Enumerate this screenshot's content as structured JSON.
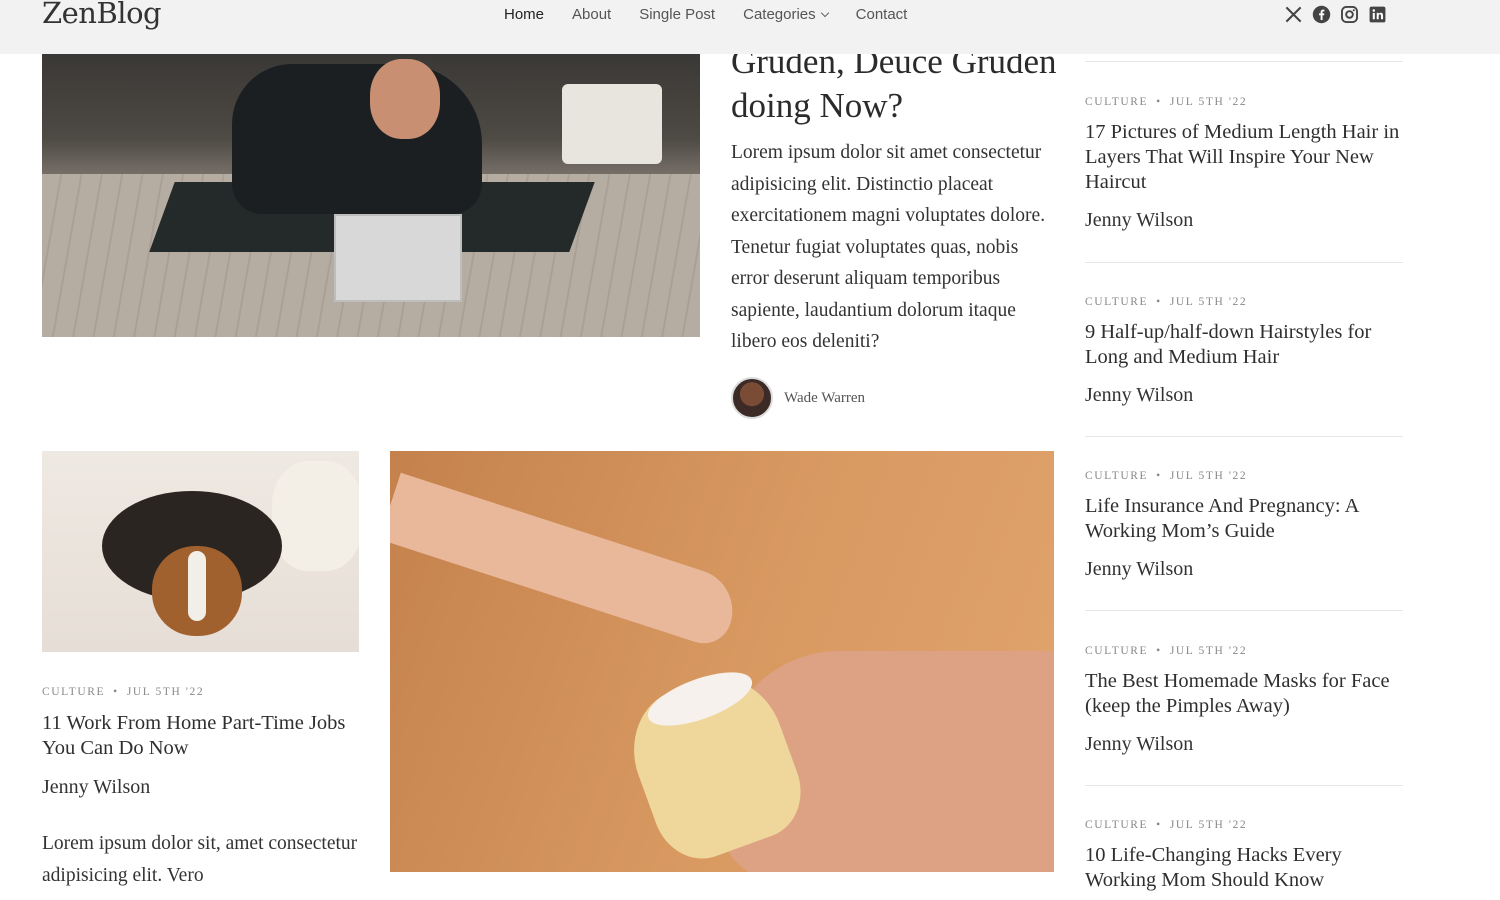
{
  "header": {
    "logo": "ZenBlog",
    "nav": [
      {
        "label": "Home"
      },
      {
        "label": "About"
      },
      {
        "label": "Single Post"
      },
      {
        "label": "Categories"
      },
      {
        "label": "Contact"
      }
    ],
    "social_icons": [
      "x-icon",
      "facebook-icon",
      "instagram-icon",
      "linkedin-icon"
    ]
  },
  "hero": {
    "title": "Gruden, Deuce Gruden doing Now?",
    "excerpt": "Lorem ipsum dolor sit amet consectetur adipisicing elit. Distinctio placeat exercitationem magni voluptates dolore. Tenetur fugiat voluptates quas, nobis error deserunt aliquam temporibus sapiente, laudantium dolorum itaque libero eos deleniti?",
    "author": "Wade Warren"
  },
  "card": {
    "category": "Culture",
    "date": "Jul 5th '22",
    "title": "11 Work From Home Part-Time Jobs You Can Do Now",
    "author": "Jenny Wilson",
    "excerpt": "Lorem ipsum dolor sit, amet consectetur adipisicing elit. Vero"
  },
  "sidebar": {
    "items": [
      {
        "category": "Culture",
        "date": "Jul 5th '22",
        "title": "17 Pictures of Medium Length Hair in Layers That Will Inspire Your New Haircut",
        "author": "Jenny Wilson"
      },
      {
        "category": "Culture",
        "date": "Jul 5th '22",
        "title": "9 Half-up/half-down Hairstyles for Long and Medium Hair",
        "author": "Jenny Wilson"
      },
      {
        "category": "Culture",
        "date": "Jul 5th '22",
        "title": "Life Insurance And Pregnancy: A Working Mom’s Guide",
        "author": "Jenny Wilson"
      },
      {
        "category": "Culture",
        "date": "Jul 5th '22",
        "title": "The Best Homemade Masks for Face (keep the Pimples Away)",
        "author": "Jenny Wilson"
      },
      {
        "category": "Culture",
        "date": "Jul 5th '22",
        "title": "10 Life-Changing Hacks Every Working Mom Should Know",
        "author": ""
      }
    ]
  }
}
